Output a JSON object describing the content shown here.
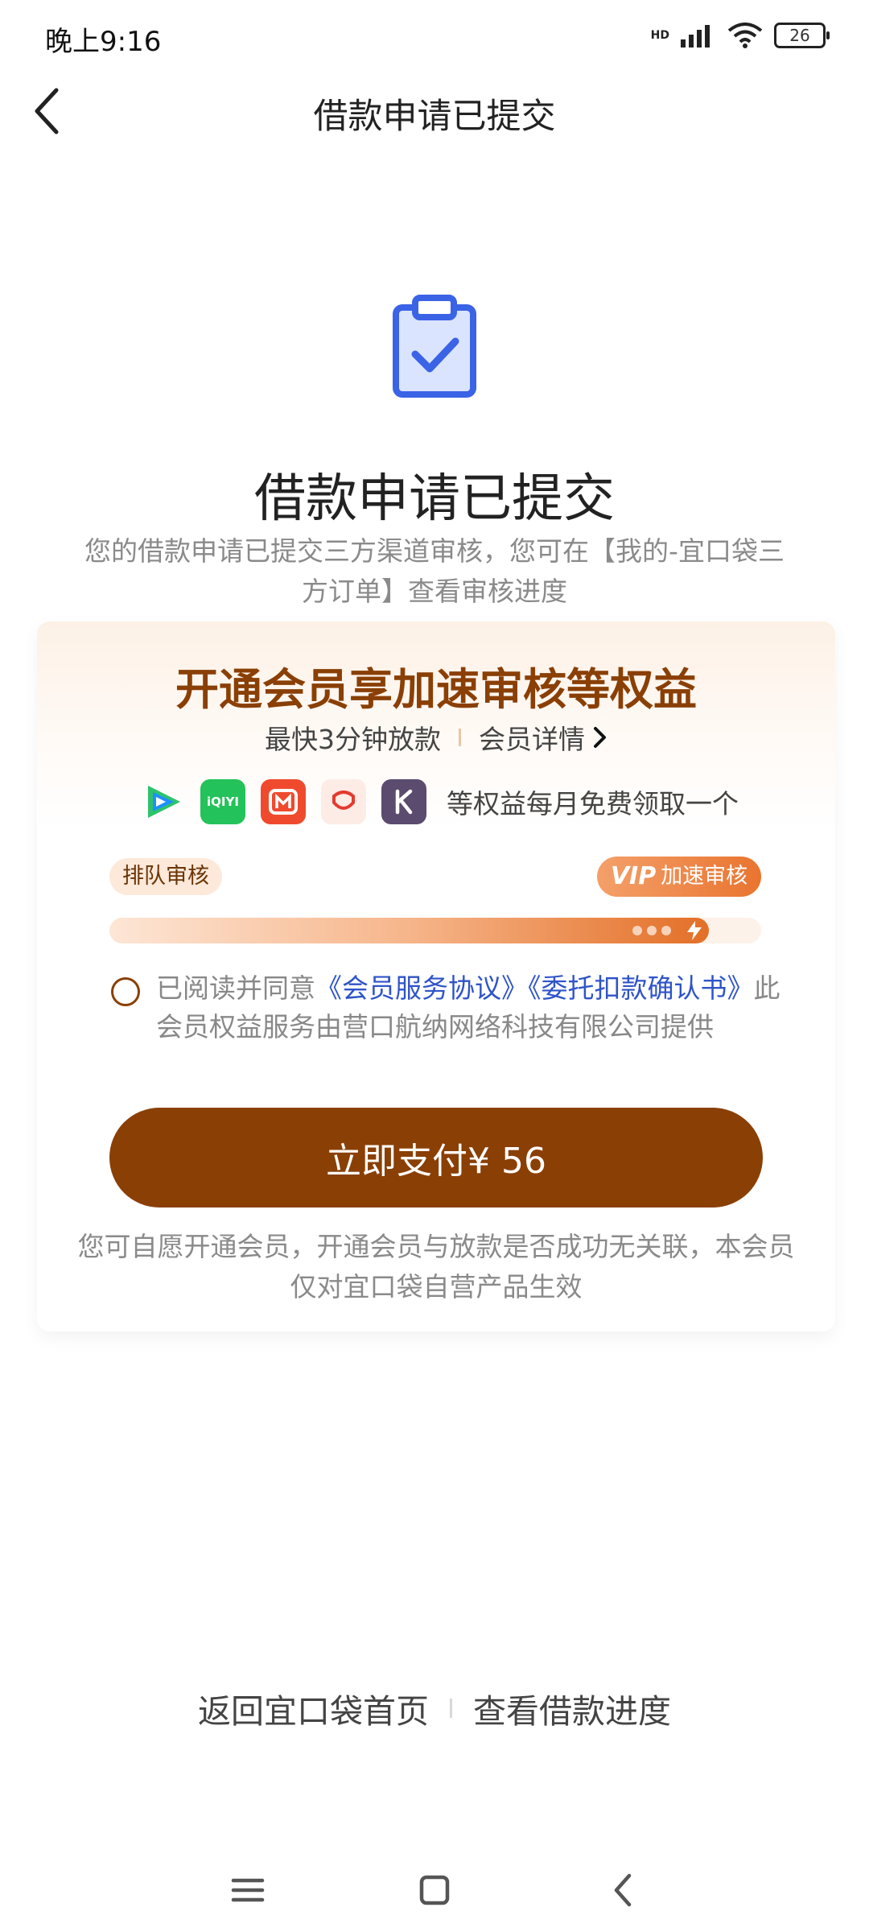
{
  "status_bar": {
    "time": "晚上9:16",
    "network": "HD",
    "battery": "26"
  },
  "nav": {
    "title": "借款申请已提交"
  },
  "hero": {
    "title": "借款申请已提交",
    "description": "您的借款申请已提交三方渠道审核，您可在【我的-宜口袋三方订单】查看审核进度"
  },
  "member_card": {
    "title": "开通会员享加速审核等权益",
    "fastest_text": "最快3分钟放款",
    "detail_link": "会员详情",
    "benefit_apps": [
      "tencent-video",
      "iqiyi",
      "mango-tv",
      "jd",
      "keep"
    ],
    "benefit_app_labels": {
      "iqiyi": "iQIYI"
    },
    "benefit_text": "等权益每月免费领取一个",
    "queue_label": "排队审核",
    "vip_badge": "VIP",
    "vip_label": "加速审核",
    "progress": 0.92,
    "agreement": {
      "prefix": "已阅读并同意",
      "link1": "《会员服务协议》",
      "link2": "《委托扣款确认书》",
      "suffix": "此会员权益服务由营口航纳网络科技有限公司提供",
      "checked": false
    },
    "pay_button": "立即支付¥ 56",
    "note": "您可自愿开通会员，开通会员与放款是否成功无关联，本会员仅对宜口袋自营产品生效"
  },
  "footer": {
    "home_link": "返回宜口袋首页",
    "progress_link": "查看借款进度"
  },
  "colors": {
    "brand_brown": "#8a3f05",
    "vip_orange": "#e9742f",
    "link_blue": "#2f54c8",
    "icon_blue": "#3b63e6"
  }
}
